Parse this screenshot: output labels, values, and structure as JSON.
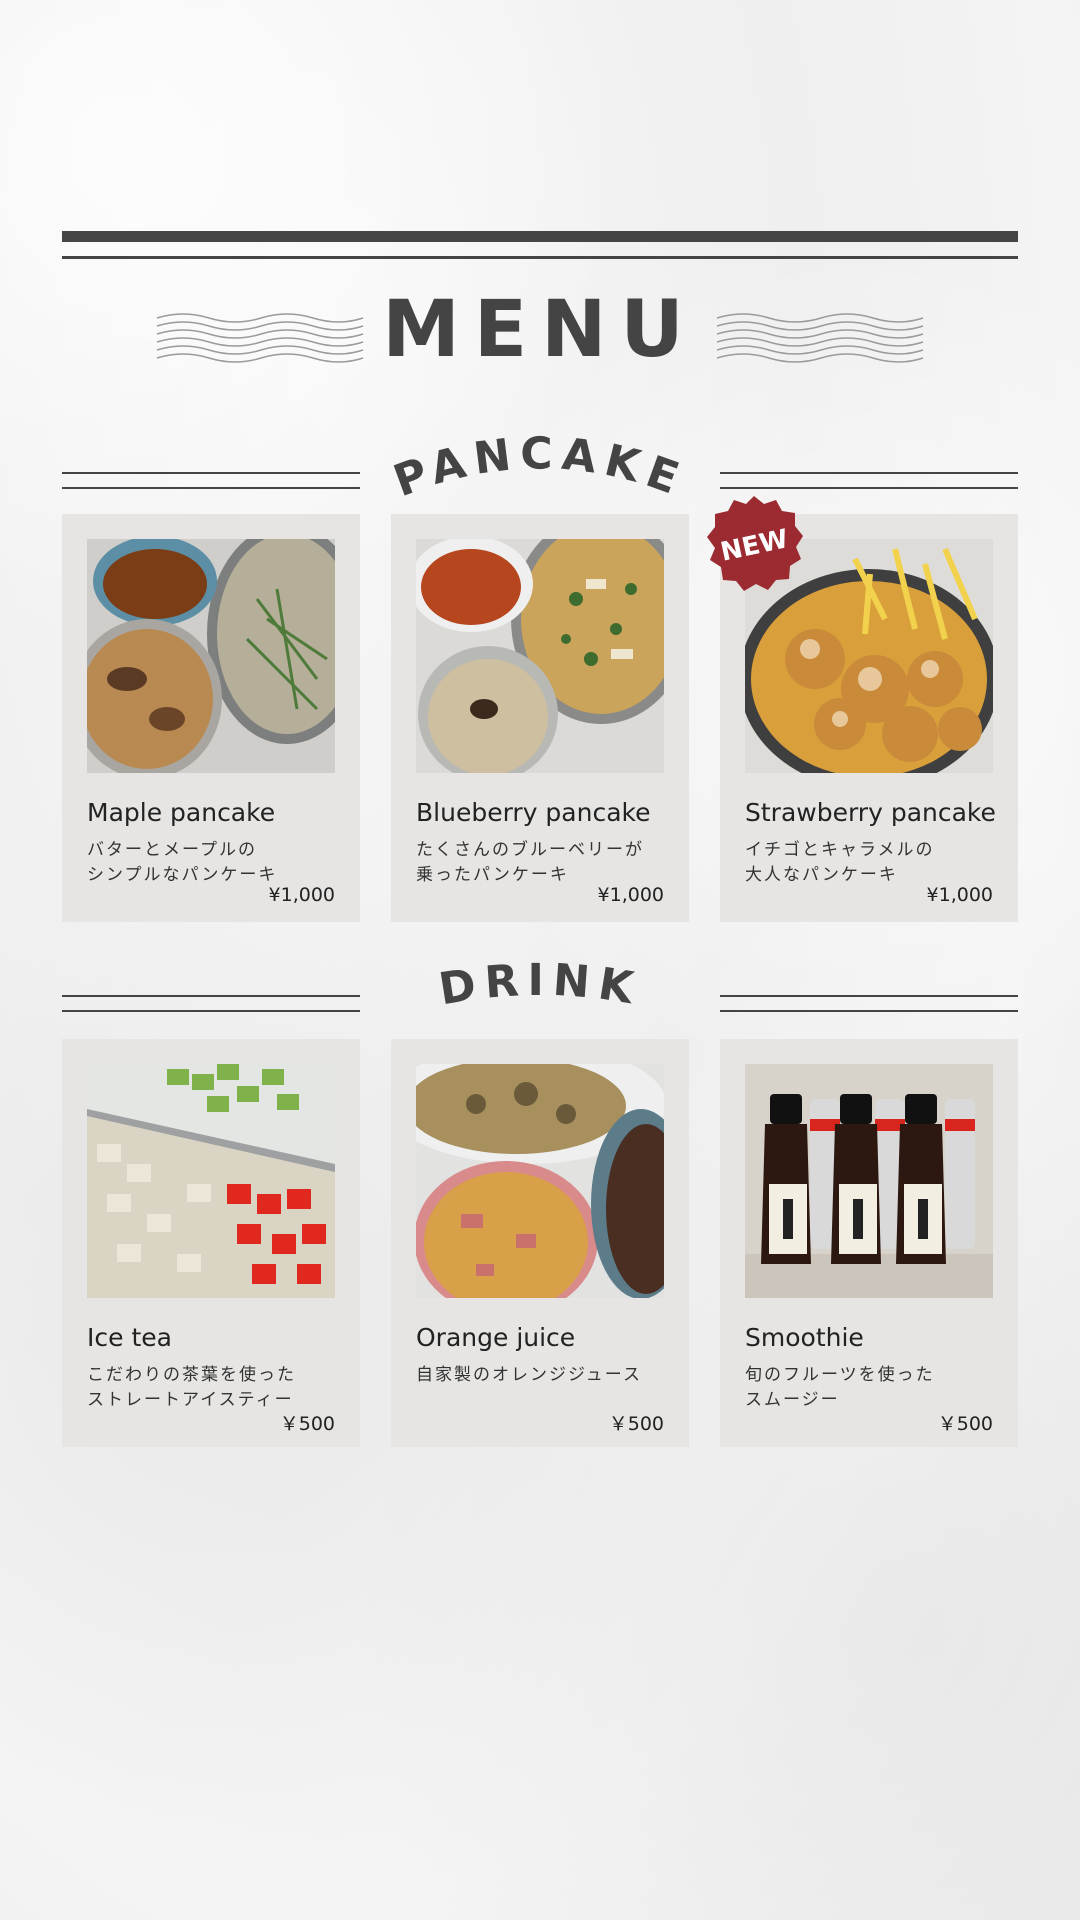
{
  "title": "MENU",
  "sections": [
    {
      "heading": "PANCAKE",
      "items": [
        {
          "name": "Maple pancake",
          "desc": [
            "バターとメープルの",
            "シンプルなパンケーキ"
          ],
          "price": "¥1,000",
          "photo": "rice-bowls-plate"
        },
        {
          "name": "Blueberry pancake",
          "desc": [
            "たくさんのブルーベリーが",
            "乗ったパンケーキ"
          ],
          "price": "¥1,000",
          "photo": "stirfry-rice-plate"
        },
        {
          "name": "Strawberry pancake",
          "desc": [
            "イチゴとキャラメルの",
            "大人なパンケーキ"
          ],
          "price": "¥1,000",
          "photo": "fried-chicken-fries",
          "badge": "NEW"
        }
      ]
    },
    {
      "heading": "DRINK",
      "items": [
        {
          "name": "Ice tea",
          "desc": [
            "こだわりの茶葉を使った",
            "ストレートアイスティー"
          ],
          "price": "￥500",
          "photo": "chopped-vegetables"
        },
        {
          "name": "Orange juice",
          "desc": [
            "自家製のオレンジジュース"
          ],
          "price": "￥500",
          "photo": "rice-stew-plate"
        },
        {
          "name": "Smoothie",
          "desc": [
            "旬のフルーツを使った",
            "スムージー"
          ],
          "price": "￥500",
          "photo": "sauce-bottles"
        }
      ]
    }
  ],
  "colors": {
    "ink": "#444444",
    "card": "#e6e5e3",
    "badge": "#9b2b30"
  }
}
